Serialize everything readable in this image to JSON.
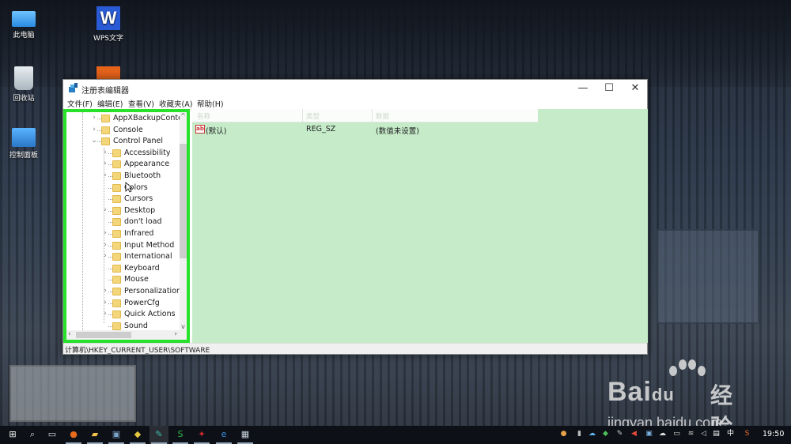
{
  "desktop": {
    "icons": [
      {
        "label": "此电脑",
        "icon": "computer-icon"
      },
      {
        "label": "回收站",
        "icon": "recycle-bin-icon"
      },
      {
        "label": "控制面板",
        "icon": "control-panel-icon"
      },
      {
        "label": "WPS文字",
        "icon": "wps-writer-icon"
      }
    ]
  },
  "window": {
    "title": "注册表编辑器",
    "controls": {
      "minimize": "—",
      "maximize": "☐",
      "close": "✕"
    },
    "menu": [
      "文件(F)",
      "编辑(E)",
      "查看(V)",
      "收藏夹(A)",
      "帮助(H)"
    ],
    "tree": [
      {
        "label": "AppXBackupConter",
        "level": 1,
        "expander": "›"
      },
      {
        "label": "Console",
        "level": 1,
        "expander": "›"
      },
      {
        "label": "Control Panel",
        "level": 1,
        "expander": "⌄"
      },
      {
        "label": "Accessibility",
        "level": 2,
        "expander": "›"
      },
      {
        "label": "Appearance",
        "level": 2,
        "expander": "›"
      },
      {
        "label": "Bluetooth",
        "level": 2,
        "expander": "›"
      },
      {
        "label": "Colors",
        "level": 2,
        "expander": ""
      },
      {
        "label": "Cursors",
        "level": 2,
        "expander": ""
      },
      {
        "label": "Desktop",
        "level": 2,
        "expander": "›"
      },
      {
        "label": "don't load",
        "level": 2,
        "expander": ""
      },
      {
        "label": "Infrared",
        "level": 2,
        "expander": "›"
      },
      {
        "label": "Input Method",
        "level": 2,
        "expander": "›"
      },
      {
        "label": "International",
        "level": 2,
        "expander": "›"
      },
      {
        "label": "Keyboard",
        "level": 2,
        "expander": ""
      },
      {
        "label": "Mouse",
        "level": 2,
        "expander": ""
      },
      {
        "label": "Personalization",
        "level": 2,
        "expander": "›"
      },
      {
        "label": "PowerCfg",
        "level": 2,
        "expander": "›"
      },
      {
        "label": "Quick Actions",
        "level": 2,
        "expander": "›"
      },
      {
        "label": "Sound",
        "level": 2,
        "expander": ""
      }
    ],
    "values": {
      "columns": [
        "名称",
        "类型",
        "数据"
      ],
      "rows": [
        {
          "name": "(默认)",
          "type": "REG_SZ",
          "data": "(数值未设置)",
          "icon": "ab"
        }
      ]
    },
    "status_path": "计算机\\HKEY_CURRENT_USER\\SOFTWARE",
    "highlight_color": "#27e12b",
    "values_bg": "#c5ebc9"
  },
  "watermark": {
    "brand": "Bai",
    "paw_text": "du",
    "cn": "经验",
    "url": "jingyan.baidu.com"
  },
  "taskbar": {
    "apps": [
      "start",
      "search",
      "task-view",
      "firefox",
      "file-explorer",
      "remote-desktop",
      "photos",
      "regedit",
      "wps-spreadsheet",
      "app-red",
      "internet-explorer",
      "app-window"
    ],
    "tray": [
      "network-globe",
      "tablet",
      "onedrive",
      "360",
      "pen",
      "volume-red",
      "app-tray",
      "cloud",
      "battery",
      "wifi",
      "mute",
      "notifications",
      "中",
      "sogou"
    ],
    "ime": "中",
    "clock": "19:50"
  }
}
